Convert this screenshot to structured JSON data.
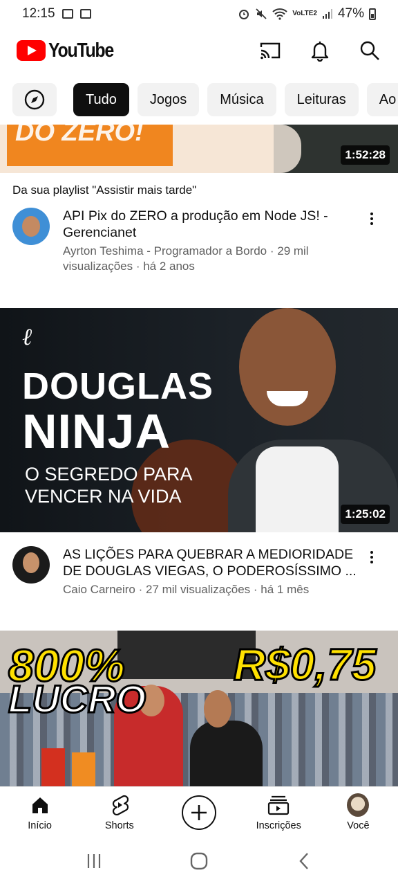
{
  "status_bar": {
    "time": "12:15",
    "battery": "47%"
  },
  "header": {
    "logo_text": "YouTube",
    "brand_color": "#ff0000"
  },
  "chips": {
    "explore_icon": "compass-icon",
    "items": [
      {
        "label": "Tudo",
        "active": true
      },
      {
        "label": "Jogos",
        "active": false
      },
      {
        "label": "Música",
        "active": false
      },
      {
        "label": "Leituras",
        "active": false
      },
      {
        "label": "Ao vivo",
        "active": false
      }
    ]
  },
  "feed": {
    "video1": {
      "duration": "1:52:28",
      "playlist_note": "Da sua playlist \"Assistir mais tarde\"",
      "title": "API Pix do ZERO a produção em Node JS! - Gerencianet",
      "subtitle": "Ayrton Teshima - Programador a Bordo · 29 mil visualizações · há 2 anos",
      "thumb_text": "DO ZERO!"
    },
    "video2": {
      "thumb_line1": "DOUGLAS",
      "thumb_line2": "NINJA",
      "thumb_line3": "O SEGREDO PARA",
      "thumb_line4": "VENCER NA VIDA",
      "duration": "1:25:02",
      "title": "AS LIÇÕES PARA QUEBRAR A MEDIORIDADE DE DOUGLAS VIEGAS, O PODEROSÍSSIMO ...",
      "subtitle": "Caio Carneiro · 27 mil visualizações · há 1 mês"
    },
    "video3": {
      "thumb_text1": "800%",
      "thumb_text2": "LUCRO",
      "thumb_text3": "R$0,75"
    }
  },
  "bottom_nav": {
    "items": [
      {
        "label": "Início",
        "icon": "home-icon"
      },
      {
        "label": "Shorts",
        "icon": "shorts-icon"
      },
      {
        "label": "",
        "icon": "create-icon"
      },
      {
        "label": "Inscrições",
        "icon": "subscriptions-icon"
      },
      {
        "label": "Você",
        "icon": "avatar"
      }
    ]
  }
}
